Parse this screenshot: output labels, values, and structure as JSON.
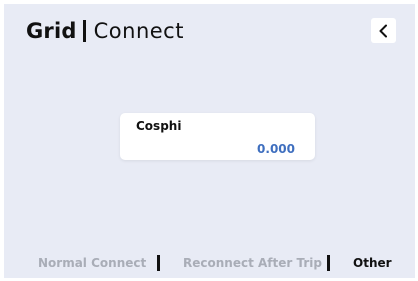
{
  "header": {
    "title": "Grid",
    "subtitle": "Connect",
    "back_icon": "chevron-left-icon"
  },
  "parameter": {
    "label": "Cosphi",
    "value": "0.000",
    "value_color": "#3f6fbf"
  },
  "tabs": [
    {
      "label": "Normal Connect",
      "active": false
    },
    {
      "label": "Reconnect After Trip",
      "active": false
    },
    {
      "label": "Other",
      "active": true
    }
  ],
  "colors": {
    "background": "#e8ebf5",
    "inactive_tab": "#a9adb7",
    "active_tab": "#111111"
  }
}
